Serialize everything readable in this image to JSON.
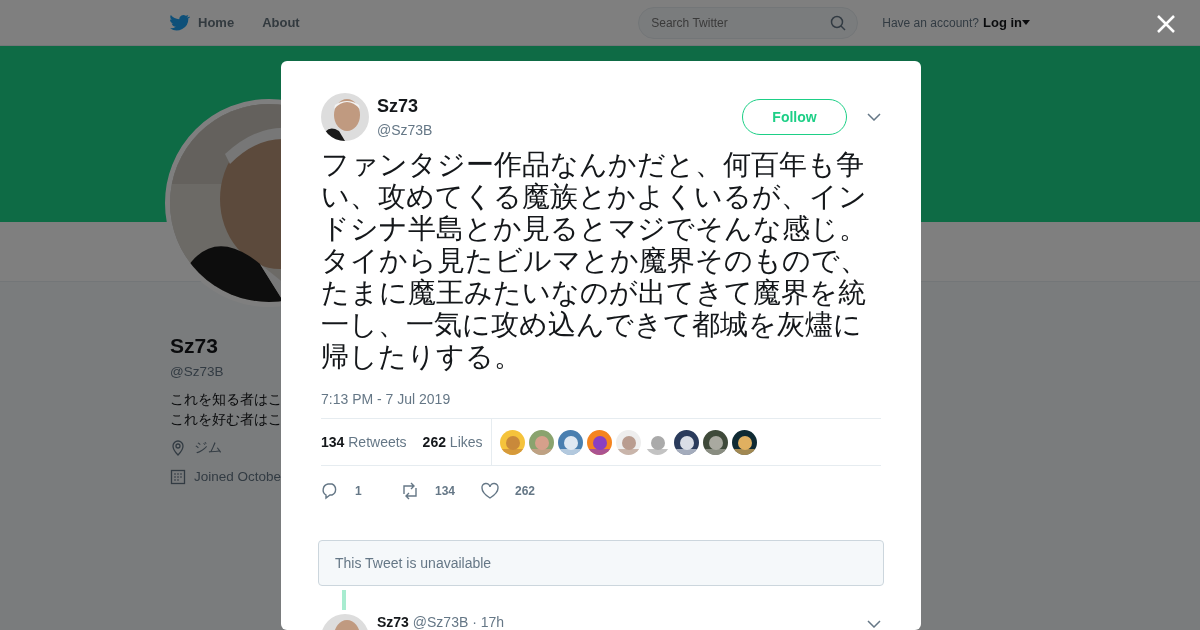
{
  "navbar": {
    "items": [
      {
        "label": "Home",
        "kind": "home"
      },
      {
        "label": "About",
        "kind": "plain"
      }
    ],
    "search": {
      "placeholder": "Search Twitter"
    },
    "account_prompt": "Have an account?",
    "login": "Log in"
  },
  "profile": {
    "name": "Sz73",
    "handle": "@Sz73B",
    "bio": [
      "これを知る者はこ",
      "これを好む者はこ"
    ],
    "location": "ジム",
    "joined": "Joined Octobe"
  },
  "tweet": {
    "name": "Sz73",
    "handle": "@Sz73B",
    "follow": "Follow",
    "text": "ファンタジー作品なんかだと、何百年も争い、攻めてくる魔族とかよくいるが、インドシナ半島とか見るとマジでそんな感じ。タイから見たビルマとか魔界そのもので、たまに魔王みたいなのが出てきて魔界を統一し、一気に攻め込んできて都城を灰燼に帰したりする。",
    "time": "7:13 PM - 7 Jul 2019",
    "stats": [
      {
        "count": "134",
        "label": "Retweets"
      },
      {
        "count": "262",
        "label": "Likes"
      }
    ],
    "actions": [
      {
        "kind": "reply",
        "count": "1"
      },
      {
        "kind": "retweet",
        "count": "134"
      },
      {
        "kind": "like",
        "count": "262"
      }
    ]
  },
  "unavailable": "This Tweet is unavailable",
  "reply": {
    "name": "Sz73",
    "handle": "@Sz73B",
    "age": "· 17h"
  }
}
